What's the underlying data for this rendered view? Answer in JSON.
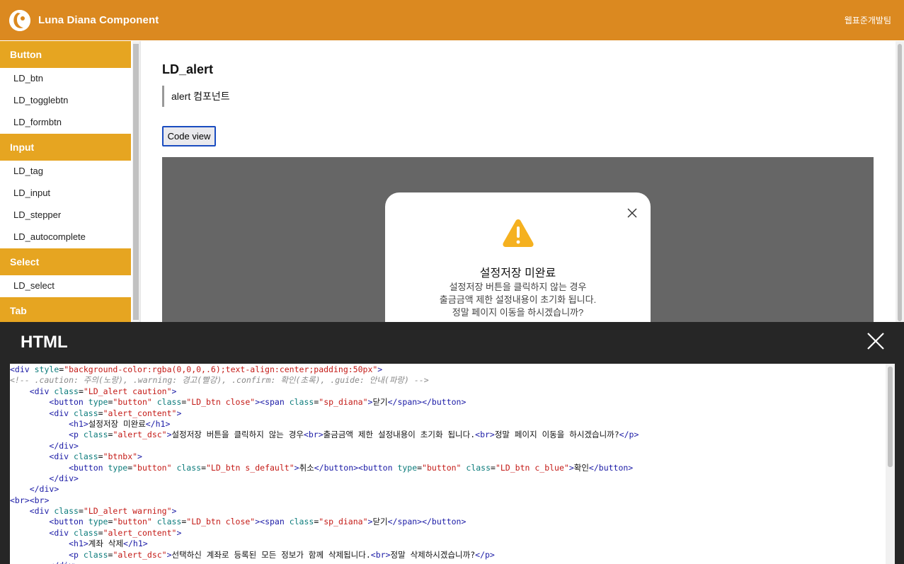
{
  "header": {
    "brand": "Luna Diana Component",
    "team": "웹표준개발팀"
  },
  "sidebar": {
    "groups": [
      {
        "label": "Button",
        "items": [
          "LD_btn",
          "LD_togglebtn",
          "LD_formbtn"
        ]
      },
      {
        "label": "Input",
        "items": [
          "LD_tag",
          "LD_input",
          "LD_stepper",
          "LD_autocomplete"
        ]
      },
      {
        "label": "Select",
        "items": [
          "LD_select"
        ]
      },
      {
        "label": "Tab",
        "items": []
      }
    ]
  },
  "main": {
    "title": "LD_alert",
    "description": "alert 컴포넌트",
    "code_view_label": "Code view",
    "alert": {
      "title": "설정저장 미완료",
      "lines": [
        "설정저장 버튼을 클릭하지 않는 경우",
        "출금금액 제한 설정내용이 초기화 됩니다.",
        "정말 페이지 이동을 하시겠습니까?"
      ]
    }
  },
  "modal": {
    "title": "HTML",
    "code_lines": [
      [
        [
          "tg",
          "<div "
        ],
        [
          "at",
          "style"
        ],
        [
          "tx",
          "="
        ],
        [
          "vl",
          "\"background-color:rgba(0,0,0,.6);text-align:center;padding:50px\""
        ],
        [
          "tg",
          ">"
        ]
      ],
      [
        [
          "cm",
          "<!-- .caution: 주의(노랑), .warning: 경고(빨강), .confirm: 확인(초록), .guide: 안내(파랑) -->"
        ]
      ],
      [
        [
          "tx",
          "    "
        ],
        [
          "tg",
          "<div "
        ],
        [
          "at",
          "class"
        ],
        [
          "tx",
          "="
        ],
        [
          "vl",
          "\"LD_alert caution\""
        ],
        [
          "tg",
          ">"
        ]
      ],
      [
        [
          "tx",
          "        "
        ],
        [
          "tg",
          "<button "
        ],
        [
          "at",
          "type"
        ],
        [
          "tx",
          "="
        ],
        [
          "vl",
          "\"button\" "
        ],
        [
          "at",
          "class"
        ],
        [
          "tx",
          "="
        ],
        [
          "vl",
          "\"LD_btn close\""
        ],
        [
          "tg",
          "><span "
        ],
        [
          "at",
          "class"
        ],
        [
          "tx",
          "="
        ],
        [
          "vl",
          "\"sp_diana\""
        ],
        [
          "tg",
          ">"
        ],
        [
          "tx",
          "닫기"
        ],
        [
          "tg",
          "</span></button>"
        ]
      ],
      [
        [
          "tx",
          "        "
        ],
        [
          "tg",
          "<div "
        ],
        [
          "at",
          "class"
        ],
        [
          "tx",
          "="
        ],
        [
          "vl",
          "\"alert_content\""
        ],
        [
          "tg",
          ">"
        ]
      ],
      [
        [
          "tx",
          "            "
        ],
        [
          "tg",
          "<h1>"
        ],
        [
          "tx",
          "설정저장 미완료"
        ],
        [
          "tg",
          "</h1>"
        ]
      ],
      [
        [
          "tx",
          "            "
        ],
        [
          "tg",
          "<p "
        ],
        [
          "at",
          "class"
        ],
        [
          "tx",
          "="
        ],
        [
          "vl",
          "\"alert_dsc\""
        ],
        [
          "tg",
          ">"
        ],
        [
          "tx",
          "설정저장 버튼을 클릭하지 않는 경우"
        ],
        [
          "tg",
          "<br>"
        ],
        [
          "tx",
          "출금금액 제한 설정내용이 초기화 됩니다."
        ],
        [
          "tg",
          "<br>"
        ],
        [
          "tx",
          "정말 페이지 이동을 하시겠습니까?"
        ],
        [
          "tg",
          "</p>"
        ]
      ],
      [
        [
          "tx",
          "        "
        ],
        [
          "tg",
          "</div>"
        ]
      ],
      [
        [
          "tx",
          "        "
        ],
        [
          "tg",
          "<div "
        ],
        [
          "at",
          "class"
        ],
        [
          "tx",
          "="
        ],
        [
          "vl",
          "\"btnbx\""
        ],
        [
          "tg",
          ">"
        ]
      ],
      [
        [
          "tx",
          "            "
        ],
        [
          "tg",
          "<button "
        ],
        [
          "at",
          "type"
        ],
        [
          "tx",
          "="
        ],
        [
          "vl",
          "\"button\" "
        ],
        [
          "at",
          "class"
        ],
        [
          "tx",
          "="
        ],
        [
          "vl",
          "\"LD_btn s_default\""
        ],
        [
          "tg",
          ">"
        ],
        [
          "tx",
          "취소"
        ],
        [
          "tg",
          "</button><button "
        ],
        [
          "at",
          "type"
        ],
        [
          "tx",
          "="
        ],
        [
          "vl",
          "\"button\" "
        ],
        [
          "at",
          "class"
        ],
        [
          "tx",
          "="
        ],
        [
          "vl",
          "\"LD_btn c_blue\""
        ],
        [
          "tg",
          ">"
        ],
        [
          "tx",
          "확인"
        ],
        [
          "tg",
          "</button>"
        ]
      ],
      [
        [
          "tx",
          "        "
        ],
        [
          "tg",
          "</div>"
        ]
      ],
      [
        [
          "tx",
          "    "
        ],
        [
          "tg",
          "</div>"
        ]
      ],
      [
        [
          "tg",
          "<br><br>"
        ]
      ],
      [
        [
          "tx",
          "    "
        ],
        [
          "tg",
          "<div "
        ],
        [
          "at",
          "class"
        ],
        [
          "tx",
          "="
        ],
        [
          "vl",
          "\"LD_alert warning\""
        ],
        [
          "tg",
          ">"
        ]
      ],
      [
        [
          "tx",
          "        "
        ],
        [
          "tg",
          "<button "
        ],
        [
          "at",
          "type"
        ],
        [
          "tx",
          "="
        ],
        [
          "vl",
          "\"button\" "
        ],
        [
          "at",
          "class"
        ],
        [
          "tx",
          "="
        ],
        [
          "vl",
          "\"LD_btn close\""
        ],
        [
          "tg",
          "><span "
        ],
        [
          "at",
          "class"
        ],
        [
          "tx",
          "="
        ],
        [
          "vl",
          "\"sp_diana\""
        ],
        [
          "tg",
          ">"
        ],
        [
          "tx",
          "닫기"
        ],
        [
          "tg",
          "</span></button>"
        ]
      ],
      [
        [
          "tx",
          "        "
        ],
        [
          "tg",
          "<div "
        ],
        [
          "at",
          "class"
        ],
        [
          "tx",
          "="
        ],
        [
          "vl",
          "\"alert_content\""
        ],
        [
          "tg",
          ">"
        ]
      ],
      [
        [
          "tx",
          "            "
        ],
        [
          "tg",
          "<h1>"
        ],
        [
          "tx",
          "계좌 삭제"
        ],
        [
          "tg",
          "</h1>"
        ]
      ],
      [
        [
          "tx",
          "            "
        ],
        [
          "tg",
          "<p "
        ],
        [
          "at",
          "class"
        ],
        [
          "tx",
          "="
        ],
        [
          "vl",
          "\"alert_dsc\""
        ],
        [
          "tg",
          ">"
        ],
        [
          "tx",
          "선택하신 계좌로 등록된 모든 정보가 함께 삭제됩니다."
        ],
        [
          "tg",
          "<br>"
        ],
        [
          "tx",
          "정말 삭제하시겠습니까?"
        ],
        [
          "tg",
          "</p>"
        ]
      ],
      [
        [
          "tx",
          "        "
        ],
        [
          "tg",
          "</div>"
        ]
      ]
    ]
  },
  "colors": {
    "header": "#db8920",
    "category": "#e6a521",
    "warning": "#f5b120",
    "modal_bg": "#262626"
  }
}
